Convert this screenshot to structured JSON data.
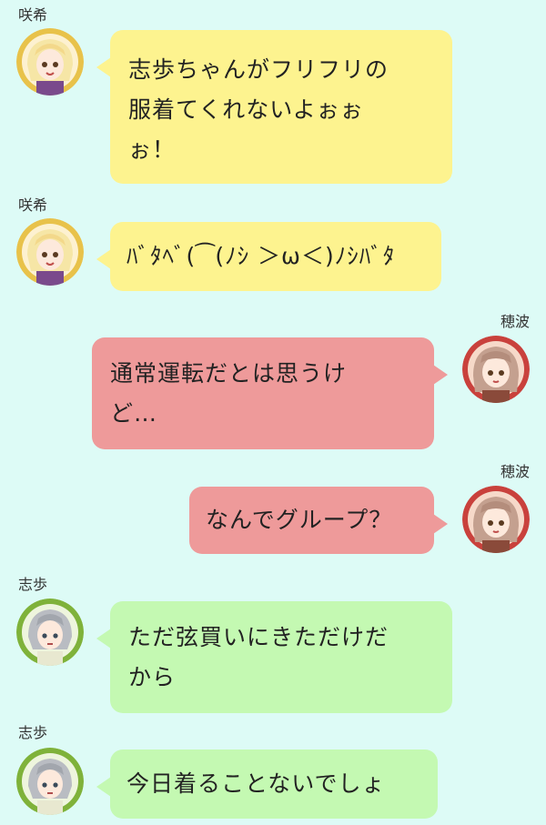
{
  "characters": {
    "saki": {
      "name": "咲希",
      "icon": "saki-avatar-icon"
    },
    "honami": {
      "name": "穂波",
      "icon": "honami-avatar-icon"
    },
    "shiho": {
      "name": "志歩",
      "icon": "shiho-avatar-icon"
    }
  },
  "messages": [
    {
      "sender": "咲希",
      "text": "志歩ちゃんがフリフリの\n服着てくれないよぉぉ\nぉ！"
    },
    {
      "sender": "咲希",
      "text": "ﾊﾞﾀﾍﾞ(⁀(ﾉｼ ＞ω＜)ﾉｼﾊﾞﾀ"
    },
    {
      "sender": "穂波",
      "text": "通常運転だとは思うけ\nど…"
    },
    {
      "sender": "穂波",
      "text": "なんでグループ？"
    },
    {
      "sender": "志歩",
      "text": "ただ弦買いにきただけだ\nから"
    },
    {
      "sender": "志歩",
      "text": "今日着ることないでしょ"
    }
  ],
  "colors": {
    "background": "#ddfbf6",
    "saki_bubble": "#fdf38f",
    "honami_bubble": "#ee9a9a",
    "shiho_bubble": "#c4f9b2"
  }
}
